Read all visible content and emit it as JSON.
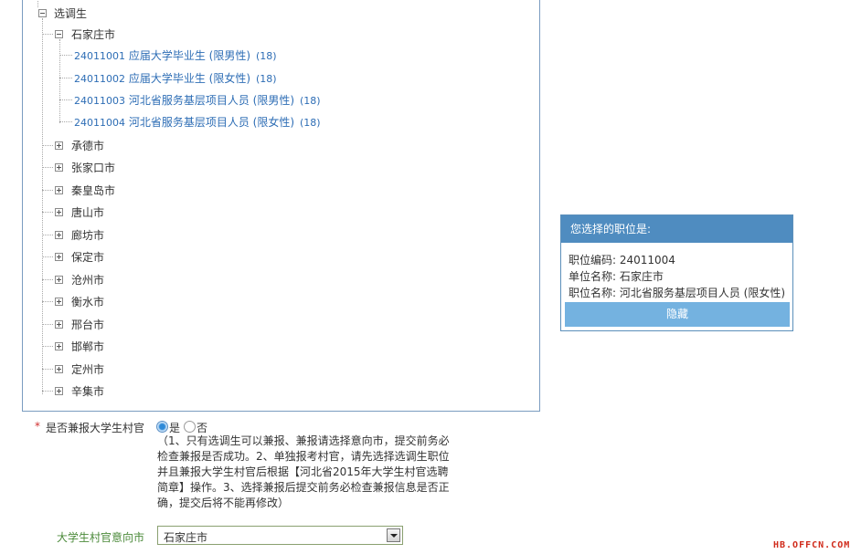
{
  "tree": {
    "root": {
      "label": "选调生"
    },
    "expanded_city": {
      "label": "石家庄市"
    },
    "positions": [
      {
        "code": "24011001",
        "name": "应届大学毕业生 (限男性)",
        "count": "(18)"
      },
      {
        "code": "24011002",
        "name": "应届大学毕业生 (限女性)",
        "count": "(18)"
      },
      {
        "code": "24011003",
        "name": "河北省服务基层项目人员 (限男性)",
        "count": "(18)"
      },
      {
        "code": "24011004",
        "name": "河北省服务基层项目人员 (限女性)",
        "count": "(18)"
      }
    ],
    "cities": [
      {
        "label": "承德市"
      },
      {
        "label": "张家口市"
      },
      {
        "label": "秦皇岛市"
      },
      {
        "label": "唐山市"
      },
      {
        "label": "廊坊市"
      },
      {
        "label": "保定市"
      },
      {
        "label": "沧州市"
      },
      {
        "label": "衡水市"
      },
      {
        "label": "邢台市"
      },
      {
        "label": "邯郸市"
      },
      {
        "label": "定州市"
      },
      {
        "label": "辛集市"
      }
    ]
  },
  "form": {
    "required_mark": "*",
    "village_question": "是否兼报大学生村官",
    "yes_label": "是",
    "no_label": "否",
    "yes_selected": true,
    "note": "（1、只有选调生可以兼报、兼报请选择意向市，提交前务必检查兼报是否成功。2、单独报考村官，请先选择选调生职位并且兼报大学生村官后根据【河北省2015年大学生村官选聘简章】操作。3、选择兼报后提交前务必检查兼报信息是否正确，提交后将不能再修改）",
    "city_label": "大学生村官意向市",
    "city_value": "石家庄市"
  },
  "panel": {
    "title": "您选择的职位是:",
    "code_line": "职位编码: 24011004",
    "unit_line": "单位名称: 石家庄市",
    "name_line": "职位名称: 河北省服务基层项目人员 (限女性)",
    "hide_button": "隐藏"
  },
  "watermark": "HB.OFFCN.COM",
  "colors": {
    "accent": "#4f8cc0",
    "button": "#74b2e0",
    "link": "#2d6db5",
    "required": "#d03030"
  }
}
